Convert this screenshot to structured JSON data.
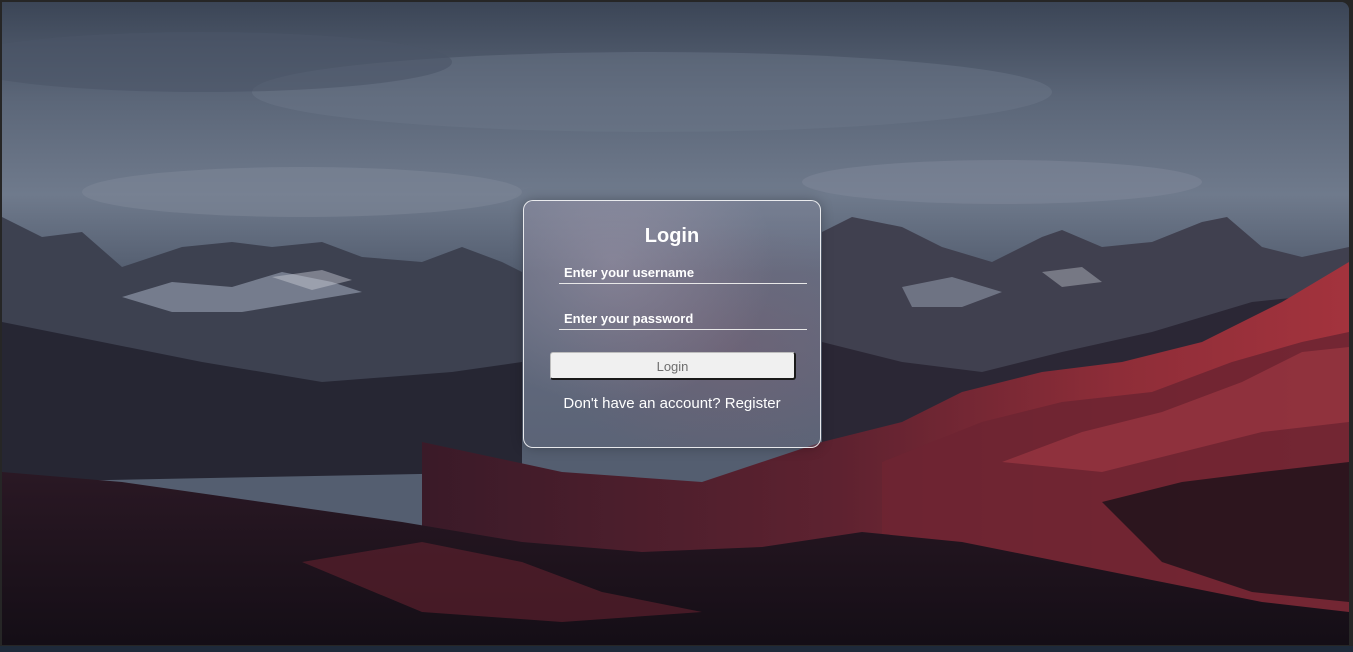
{
  "form": {
    "title": "Login",
    "username_placeholder": "Enter your username",
    "password_placeholder": "Enter your password",
    "submit_label": "Login",
    "register_prompt": "Don't have an account?",
    "register_link": "Register"
  },
  "colors": {
    "card_border": "#ffffff",
    "button_bg": "#f0f0f0",
    "button_text": "#6e6e6e",
    "text": "#ffffff"
  },
  "background": {
    "icon": "mountain-landscape-image"
  }
}
